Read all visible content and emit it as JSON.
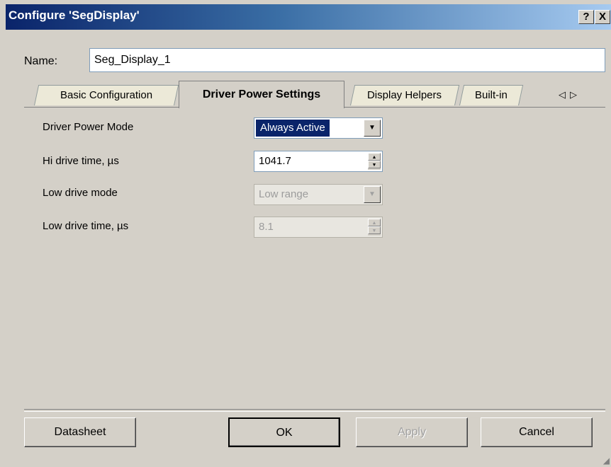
{
  "window": {
    "title": "Configure 'SegDisplay'",
    "help_label": "?",
    "close_label": "X"
  },
  "name_field": {
    "label": "Name:",
    "value": "Seg_Display_1"
  },
  "tabs": [
    {
      "label": "Basic Configuration",
      "active": false
    },
    {
      "label": "Driver Power Settings",
      "active": true
    },
    {
      "label": "Display Helpers",
      "active": false
    },
    {
      "label": "Built-in",
      "active": false
    }
  ],
  "tab_scroll": {
    "left": "◁",
    "right": "▷"
  },
  "settings": {
    "driver_power_mode": {
      "label": "Driver Power Mode",
      "value": "Always Active",
      "enabled": true
    },
    "hi_drive_time": {
      "label": "Hi drive time, µs",
      "value": "1041.7",
      "enabled": true
    },
    "low_drive_mode": {
      "label": "Low drive mode",
      "value": "Low range",
      "enabled": false
    },
    "low_drive_time": {
      "label": "Low drive time, µs",
      "value": "8.1",
      "enabled": false
    }
  },
  "buttons": {
    "datasheet": "Datasheet",
    "ok": "OK",
    "apply": "Apply",
    "cancel": "Cancel"
  },
  "colors": {
    "title_bar": "#0a246a",
    "selection": "#0a246a",
    "window_bg": "#d4d0c8"
  }
}
